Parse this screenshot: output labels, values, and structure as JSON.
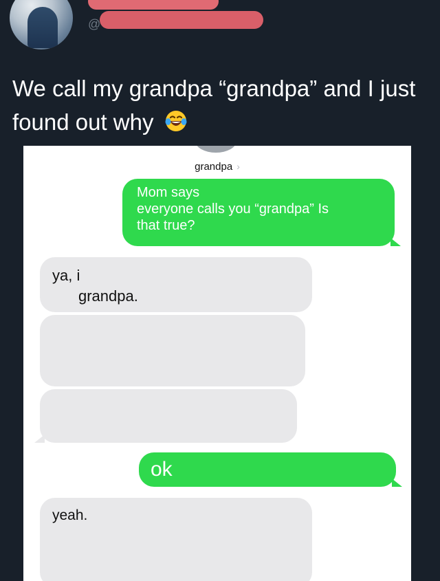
{
  "tweet": {
    "text": "We call my grandpa “grandpa” and I just found out why",
    "emoji_icon": "face-with-tears-of-joy-icon"
  },
  "imessage": {
    "contact_name": "grandpa",
    "messages": [
      {
        "sender": "me",
        "lines": [
          "Mom says",
          "everyone calls you “grandpa” Is",
          "that true?"
        ]
      },
      {
        "sender": "grandpa",
        "lines": [
          "ya, i",
          "grandpa."
        ]
      },
      {
        "sender": "grandpa",
        "lines": []
      },
      {
        "sender": "grandpa",
        "lines": []
      },
      {
        "sender": "me",
        "lines": [
          "ok"
        ]
      },
      {
        "sender": "grandpa",
        "lines": [
          "yeah."
        ]
      }
    ]
  },
  "colors": {
    "page_bg": "#18202a",
    "sent_bubble": "#2fd94d",
    "received_bubble": "#e8e8ea",
    "redaction": "#e06a73"
  }
}
